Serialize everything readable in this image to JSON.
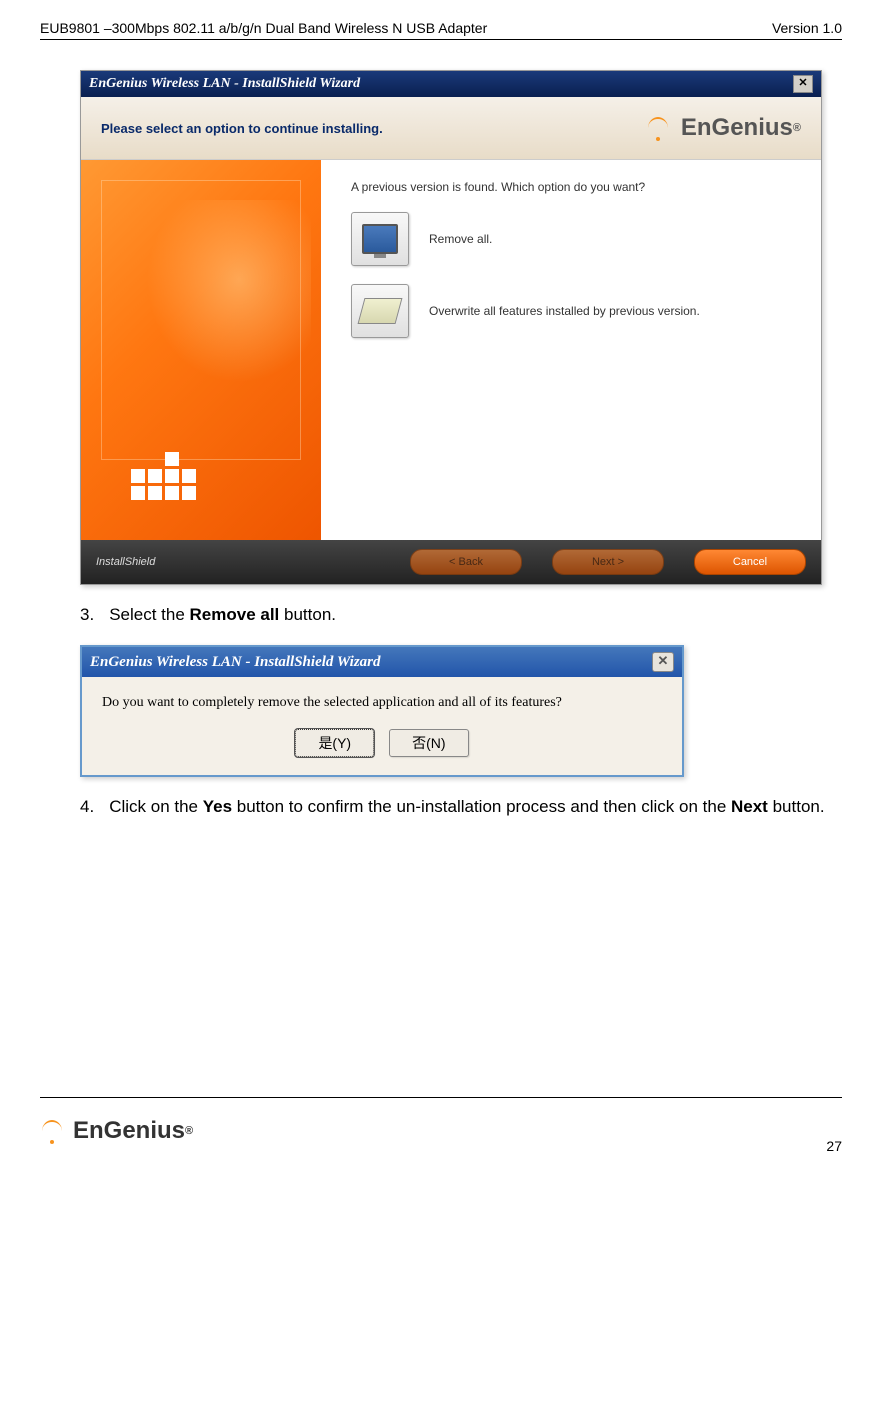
{
  "header": {
    "product": "EUB9801 –300Mbps 802.11 a/b/g/n Dual Band Wireless N USB Adapter",
    "version": "Version 1.0"
  },
  "screenshot1": {
    "title": "EnGenius Wireless LAN - InstallShield Wizard",
    "banner_text": "Please select an option to continue installing.",
    "brand": "EnGenius",
    "prompt": "A previous version is found. Which option do you want?",
    "option1": "Remove all.",
    "option2": "Overwrite all features installed by previous version.",
    "footer_label": "InstallShield",
    "btn_back": "< Back",
    "btn_next": "Next >",
    "btn_cancel": "Cancel"
  },
  "instruction1": {
    "number": "3.",
    "prefix": "Select the ",
    "bold": "Remove all",
    "suffix": " button."
  },
  "screenshot2": {
    "title": "EnGenius Wireless LAN - InstallShield Wizard",
    "message": "Do you want to completely remove the selected application and all of its features?",
    "btn_yes": "是(Y)",
    "btn_no": "否(N)"
  },
  "instruction2": {
    "number": "4.",
    "text_parts": [
      "Click on the ",
      "Yes",
      " button to confirm the un-installation process and then click on the ",
      "Next",
      " button."
    ]
  },
  "footer": {
    "brand": "EnGenius",
    "page": "27"
  }
}
